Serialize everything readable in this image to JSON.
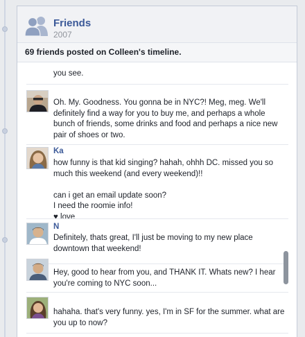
{
  "card": {
    "title": "Friends",
    "year": "2007",
    "summary": "69 friends posted on Colleen's timeline."
  },
  "icons": {
    "friends": "friends-icon"
  },
  "posts": [
    {
      "name": "",
      "text": "you see."
    },
    {
      "name": "",
      "text": "Oh. My. Goodness. You gonna be in NYC?! Meg, meg. We'll definitely find a way for you to buy me, and perhaps a whole bunch of friends, some drinks and food and perhaps a nice new pair of shoes or two."
    },
    {
      "name": "Ka",
      "text": "how funny is that kid singing? hahah, ohhh DC. missed you so much this weekend (and every weekend)!!\n\ncan i get an email update soon?\nI need the roomie info!\n♥ love"
    },
    {
      "name": "N",
      "text": "Definitely, thats great, I'll just be moving to my new place downtown that weekend!"
    },
    {
      "name": "",
      "text": "Hey, good to hear from you, and THANK IT. Whats new? I hear you're coming to NYC soon..."
    },
    {
      "name": "",
      "text": "hahaha. that's very funny. yes, I'm in SF for the summer. what are you up to now?"
    }
  ]
}
